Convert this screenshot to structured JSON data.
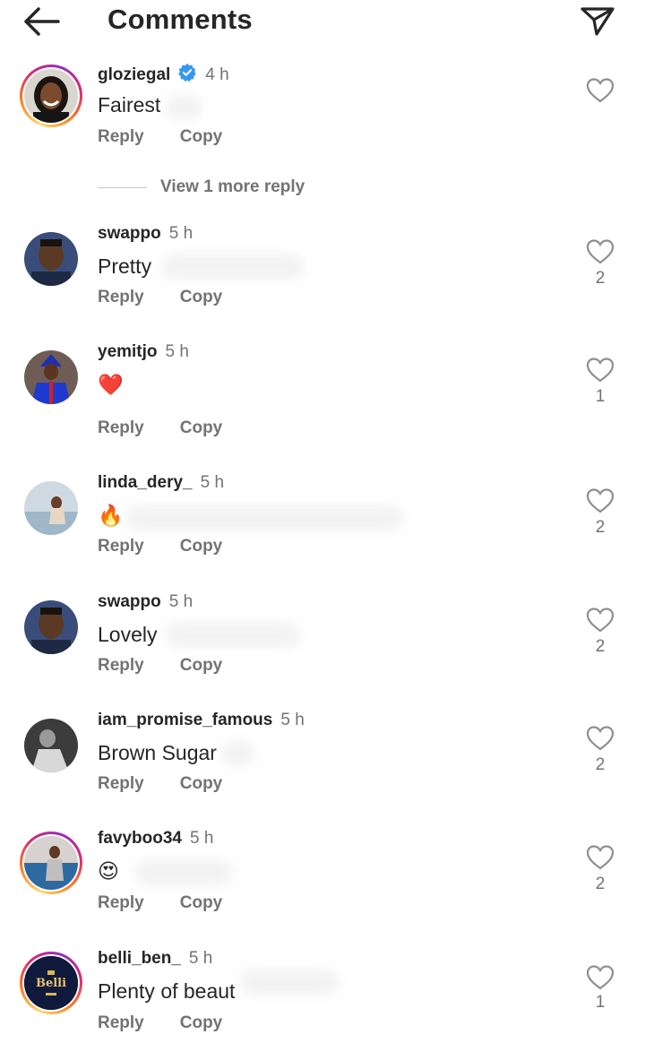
{
  "header": {
    "title": "Comments",
    "back_icon": "arrow-left-icon",
    "send_icon": "paper-plane-icon"
  },
  "labels": {
    "reply": "Reply",
    "copy": "Copy"
  },
  "view_more": "View 1 more reply",
  "colors": {
    "text": "#262626",
    "secondary": "#737373",
    "verified": "#3897f0",
    "heart_red": "#ed4956"
  },
  "comments": [
    {
      "username": "gloziegal",
      "verified": true,
      "time": "4 h",
      "text": "Fairest",
      "likes": ""
    },
    {
      "username": "swappo",
      "verified": false,
      "time": "5 h",
      "text": "Pretty",
      "likes": "2"
    },
    {
      "username": "yemitjo",
      "verified": false,
      "time": "5 h",
      "text": "❤️",
      "likes": "1"
    },
    {
      "username": "linda_dery_",
      "verified": false,
      "time": "5 h",
      "text": "🔥",
      "likes": "2"
    },
    {
      "username": "swappo",
      "verified": false,
      "time": "5 h",
      "text": "Lovely",
      "likes": "2"
    },
    {
      "username": "iam_promise_famous",
      "verified": false,
      "time": "5 h",
      "text": "Brown Sugar",
      "likes": "2"
    },
    {
      "username": "favyboo34",
      "verified": false,
      "time": "5 h",
      "text": "😍",
      "likes": "2"
    },
    {
      "username": "belli_ben_",
      "verified": false,
      "time": "5 h",
      "text": "Plenty of beaut",
      "likes": "1",
      "avatar_text": "Belli"
    }
  ]
}
